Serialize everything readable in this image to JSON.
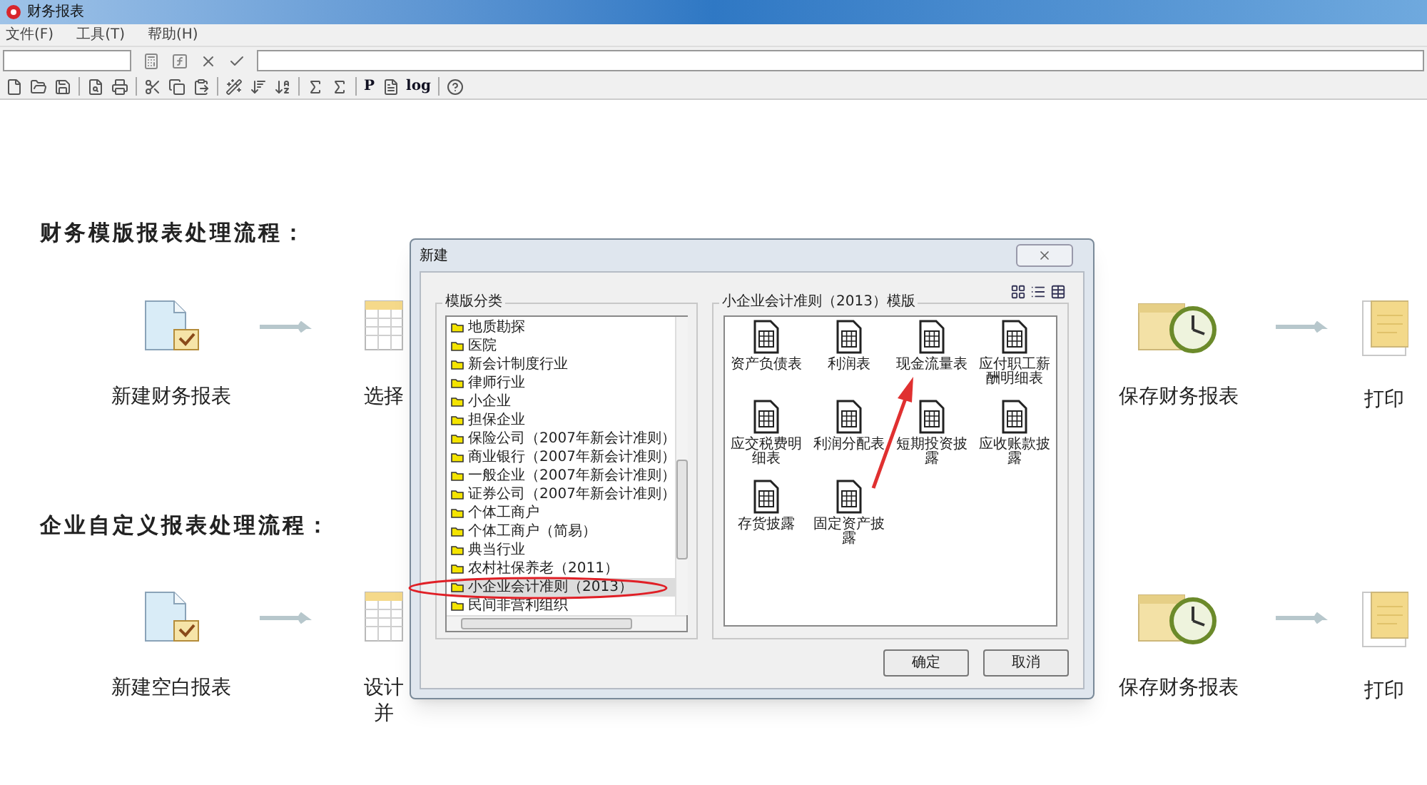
{
  "window": {
    "title": "财务报表"
  },
  "menu": [
    {
      "label": "文件(F)"
    },
    {
      "label": "工具(T)"
    },
    {
      "label": "帮助(H)"
    }
  ],
  "toolbar": [
    {
      "kind": "icon"
    },
    {
      "kind": "icon"
    },
    {
      "kind": "icon"
    },
    {
      "kind": "separator"
    },
    {
      "kind": "icon"
    },
    {
      "kind": "icon"
    },
    {
      "kind": "separator"
    },
    {
      "kind": "icon"
    },
    {
      "kind": "icon"
    },
    {
      "kind": "icon"
    },
    {
      "kind": "separator"
    },
    {
      "kind": "icon"
    },
    {
      "kind": "icon"
    },
    {
      "kind": "icon"
    },
    {
      "kind": "separator"
    },
    {
      "kind": "icon"
    },
    {
      "kind": "icon"
    },
    {
      "kind": "separator"
    },
    {
      "kind": "text",
      "label": "P"
    },
    {
      "kind": "icon"
    },
    {
      "kind": "text",
      "label": "log"
    },
    {
      "kind": "separator"
    },
    {
      "kind": "icon"
    }
  ],
  "sections": [
    {
      "heading": "财务模版报表处理流程：",
      "left_steps": [
        {
          "kind": "new",
          "lines": [
            "新建财务报表"
          ]
        },
        {
          "kind": "table",
          "lines": [
            "选择"
          ]
        }
      ],
      "right_steps": [
        {
          "kind": "calendar",
          "lines": [
            "保存财务报表"
          ]
        },
        {
          "kind": "print",
          "lines": [
            "打印"
          ]
        }
      ]
    },
    {
      "heading": "企业自定义报表处理流程：",
      "left_steps": [
        {
          "kind": "new",
          "lines": [
            "新建空白报表"
          ]
        },
        {
          "kind": "table",
          "lines": [
            "设计",
            "并"
          ]
        }
      ],
      "right_steps": [
        {
          "kind": "calendar",
          "lines": [
            "保存财务报表"
          ]
        },
        {
          "kind": "print",
          "lines": [
            "打印"
          ]
        }
      ]
    }
  ],
  "dialog": {
    "title": "新建",
    "category_group": {
      "title": "模版分类",
      "items": [
        {
          "label": "地质勘探",
          "selected": false
        },
        {
          "label": "医院",
          "selected": false
        },
        {
          "label": "新会计制度行业",
          "selected": false
        },
        {
          "label": "律师行业",
          "selected": false
        },
        {
          "label": "小企业",
          "selected": false
        },
        {
          "label": "担保企业",
          "selected": false
        },
        {
          "label": "保险公司（2007年新会计准则）",
          "selected": false
        },
        {
          "label": "商业银行（2007年新会计准则）",
          "selected": false
        },
        {
          "label": "一般企业（2007年新会计准则）",
          "selected": false
        },
        {
          "label": "证券公司（2007年新会计准则）",
          "selected": false
        },
        {
          "label": "个体工商户",
          "selected": false
        },
        {
          "label": "个体工商户（简易）",
          "selected": false
        },
        {
          "label": "典当行业",
          "selected": false
        },
        {
          "label": "农村社保养老（2011）",
          "selected": false
        },
        {
          "label": "小企业会计准则（2013）",
          "selected": true
        },
        {
          "label": "民间非营利组织",
          "selected": false
        }
      ]
    },
    "template_group": {
      "title": "小企业会计准则（2013）模版",
      "items": [
        {
          "label": "资产负债表"
        },
        {
          "label": "利润表"
        },
        {
          "label": "现金流量表"
        },
        {
          "label": "应付职工薪酬明细表"
        },
        {
          "label": "应交税费明细表"
        },
        {
          "label": "利润分配表"
        },
        {
          "label": "短期投资披露"
        },
        {
          "label": "应收账款披露"
        },
        {
          "label": "存货披露"
        },
        {
          "label": "固定资产披露"
        }
      ]
    },
    "buttons": [
      {
        "label": "确定"
      },
      {
        "label": "取消"
      }
    ]
  }
}
